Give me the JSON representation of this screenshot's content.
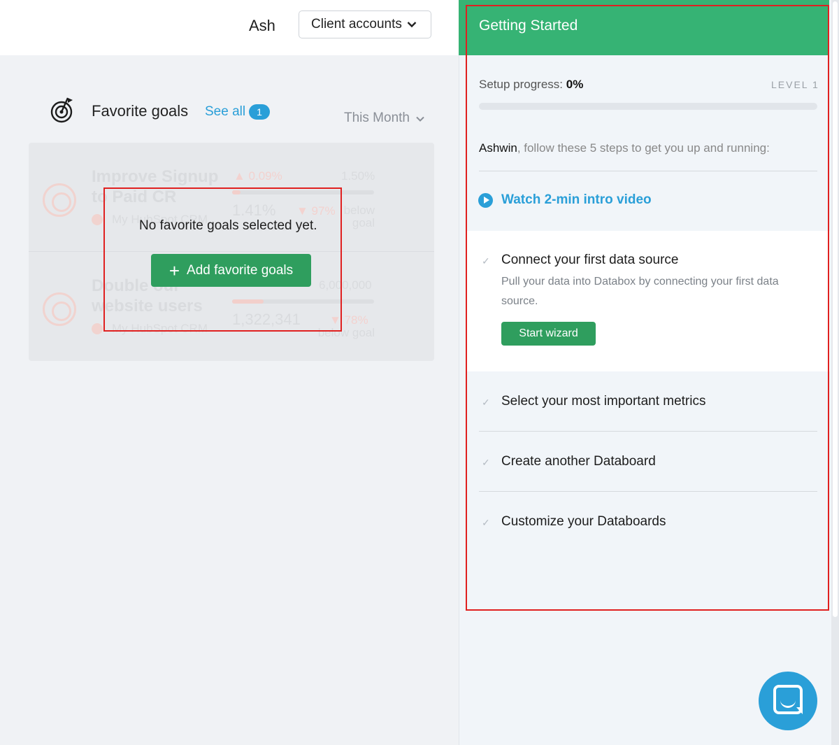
{
  "header": {
    "username": "Ash",
    "client_accounts_label": "Client accounts"
  },
  "favorites": {
    "title": "Favorite goals",
    "see_all_label": "See all",
    "see_all_count": "1",
    "period_label": "This Month",
    "empty_message": "No favorite goals selected yet.",
    "add_button_label": "Add favorite goals",
    "ghost_goals": [
      {
        "name": "Improve Signup to Paid CR",
        "source": "My HubSpot CRM",
        "change": "▲ 0.09%",
        "target": "1.50%",
        "current": "1.41%",
        "gap": "▼ 97%",
        "gap_note": "below goal",
        "progress": 0.06
      },
      {
        "name": "Double our website users",
        "source": "My HubSpot CRM",
        "change": "",
        "target": "6,000,000",
        "current": "1,322,341",
        "gap": "▼ 78%",
        "gap_note": "below goal",
        "progress": 0.22
      }
    ]
  },
  "getting_started": {
    "title": "Getting Started",
    "progress_label": "Setup progress:",
    "progress_value": "0%",
    "progress_fraction": 0,
    "level_label": "LEVEL 1",
    "intro_name": "Ashwin",
    "intro_text": ", follow these 5 steps to get you up and running:",
    "video_link": "Watch 2-min intro video",
    "steps": [
      {
        "title": "Connect your first data source",
        "description": "Pull your data into Databox by connecting your first data source.",
        "button": "Start wizard"
      },
      {
        "title": "Select your most important metrics"
      },
      {
        "title": "Create another Databoard"
      },
      {
        "title": "Customize your Databoards"
      }
    ]
  },
  "colors": {
    "brand_green": "#36b374",
    "button_green": "#2f9e5e",
    "link_blue": "#2a9fd8",
    "highlight_red": "#e02020"
  },
  "icons": {
    "favorites": "target-icon",
    "dropdown": "chevron-down-icon",
    "video": "play-icon",
    "step_status": "check-icon",
    "chat": "chat-icon"
  }
}
